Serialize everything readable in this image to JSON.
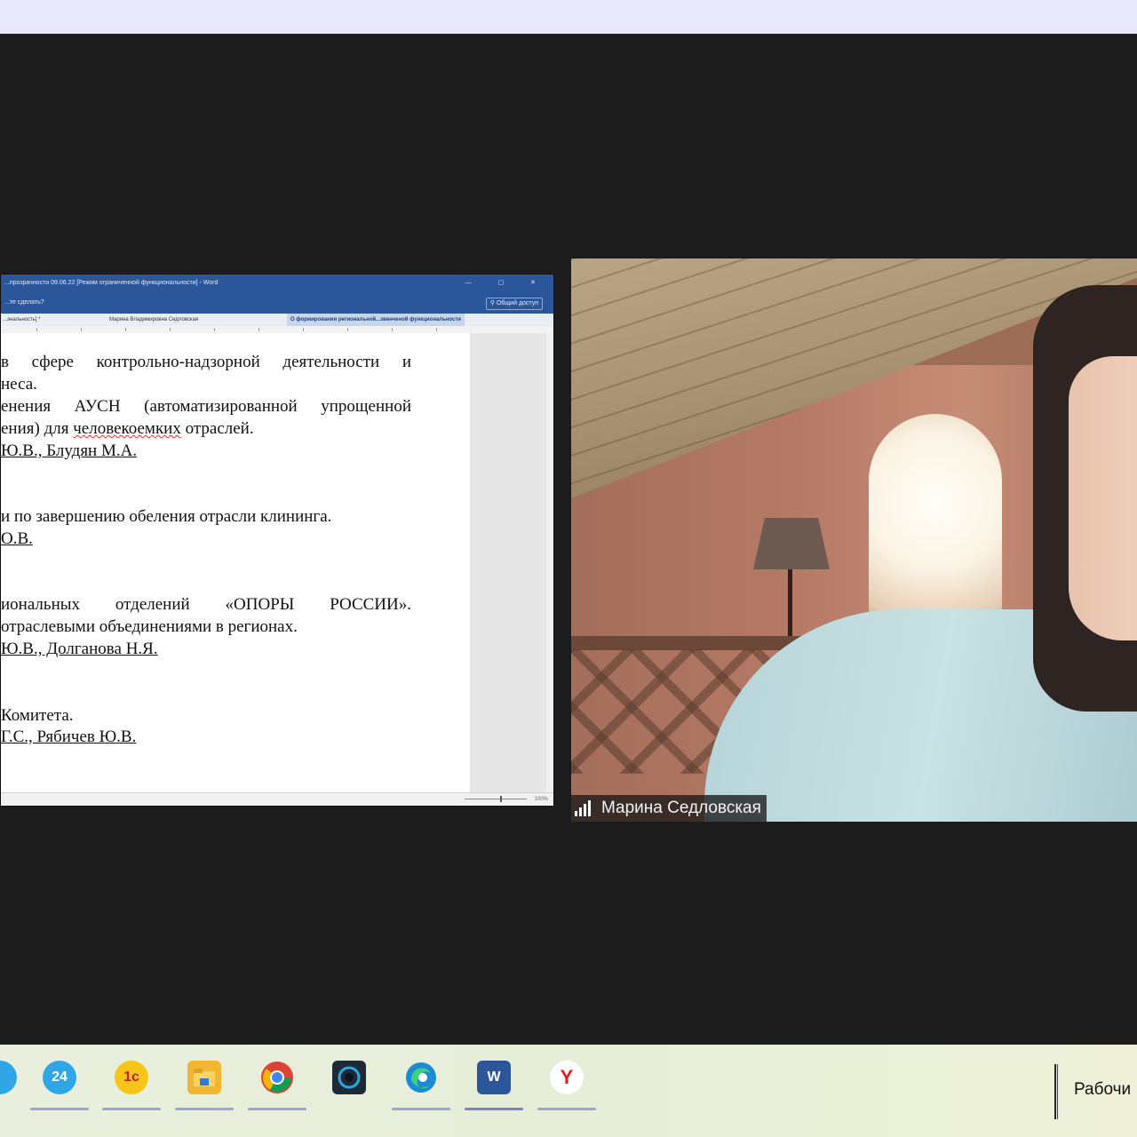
{
  "word": {
    "title": "...прозрачности 09.06.22 [Режим ограниченной функциональности] - Word",
    "ribbon_hint": "...те сделать?",
    "share_label": "Общий доступ",
    "tab_user": "Марина Владимировна Седловская",
    "tab_doc_left": "...энальность] *",
    "tab_doc_active": "О формировании региональной...звенченой функциональности",
    "zoom": "100%",
    "lines": [
      "в сфере контрольно-надзорной деятельности и",
      "неса.",
      "енения АУСН (автоматизированной упрощенной",
      "ения) для человекоемких отраслей.",
      "Ю.В., Блудян М.А.",
      "и по завершению обеления отрасли клининга.",
      "О.В.",
      "иональных отделений «ОПОРЫ РОССИИ».",
      "отраслевыми объединениями в регионах.",
      "Ю.В., Долганова Н.Я.",
      "Комитета.",
      "Г.С., Рябичев Ю.В."
    ]
  },
  "participant": {
    "name": "Марина Седловская"
  },
  "taskbar": {
    "apps": [
      {
        "name": "bitrix24-icon",
        "label": "24",
        "color": "#2fa6e6"
      },
      {
        "name": "1c-icon",
        "label": "1с",
        "color": "#f5c518"
      },
      {
        "name": "file-explorer-icon",
        "label": "",
        "color": "#f2b632"
      },
      {
        "name": "chrome-icon",
        "label": "",
        "color": "#db4437"
      },
      {
        "name": "camera-app-icon",
        "label": "",
        "color": "#1f2a38"
      },
      {
        "name": "edge-icon",
        "label": "",
        "color": "#1b8bd6"
      },
      {
        "name": "word-icon",
        "label": "W",
        "color": "#2b579a"
      },
      {
        "name": "yandex-browser-icon",
        "label": "Y",
        "color": "#e31e24"
      }
    ],
    "desktop_label": "Рабочи"
  }
}
